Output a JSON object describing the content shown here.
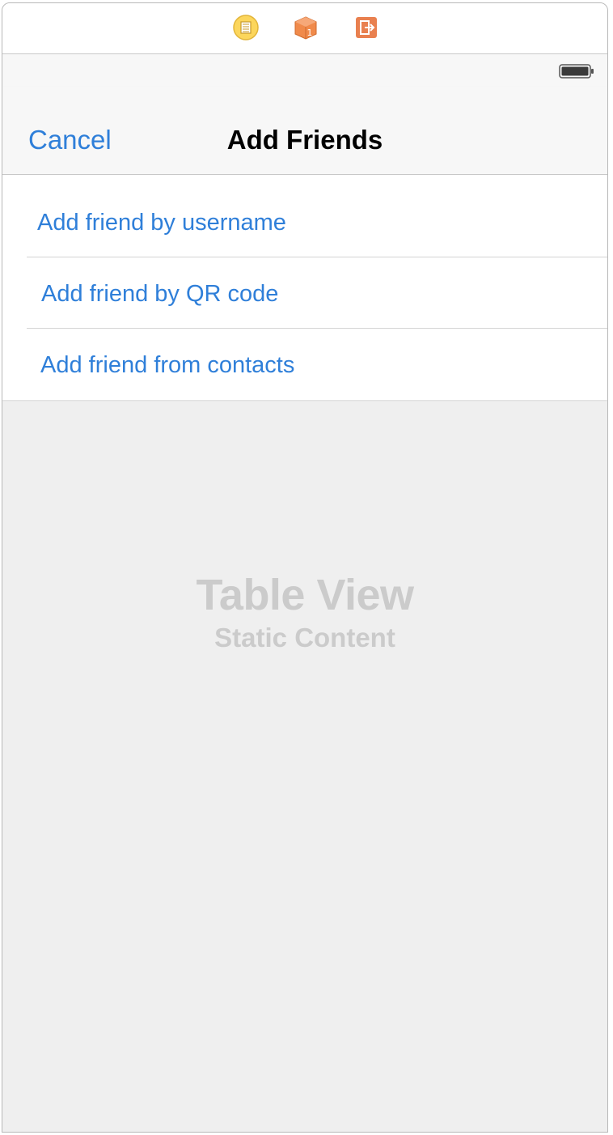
{
  "scene_dock": {
    "icons": [
      "view-controller-icon",
      "first-responder-icon",
      "exit-icon"
    ]
  },
  "nav_bar": {
    "cancel_label": "Cancel",
    "title": "Add Friends"
  },
  "table": {
    "cells": [
      {
        "label": "Add friend by username"
      },
      {
        "label": "Add friend by QR code"
      },
      {
        "label": "Add friend from contacts"
      }
    ],
    "placeholder_title": "Table View",
    "placeholder_subtitle": "Static Content"
  },
  "colors": {
    "accent": "#2f7fd9",
    "nav_background": "#f7f7f7",
    "table_background": "#efefef",
    "placeholder_text": "#cbcbcb"
  }
}
